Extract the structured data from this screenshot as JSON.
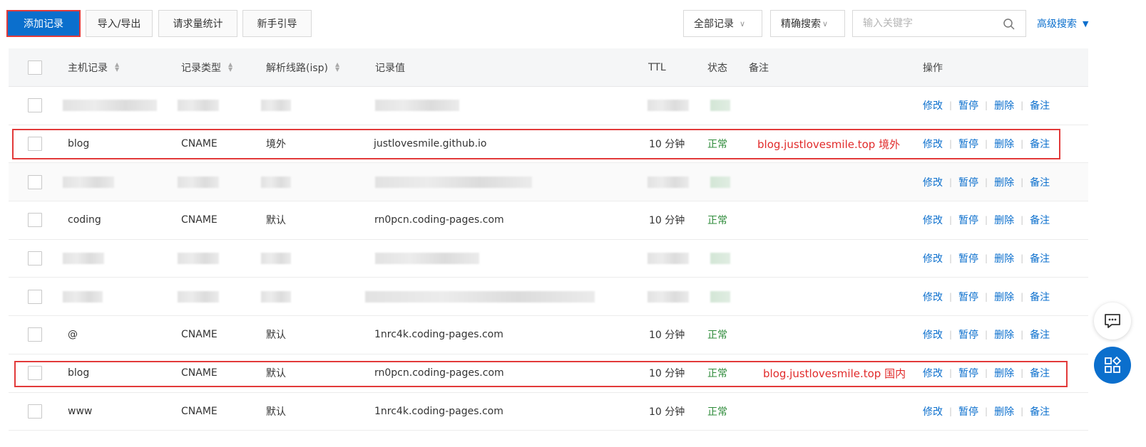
{
  "toolbar": {
    "add_record": "添加记录",
    "import_export": "导入/导出",
    "request_stats": "请求量统计",
    "newbie_guide": "新手引导",
    "all_records": "全部记录",
    "exact_search": "精确搜索",
    "search_placeholder": "输入关键字",
    "advanced_search": "高级搜索"
  },
  "table": {
    "headers": {
      "host": "主机记录",
      "type": "记录类型",
      "line": "解析线路(isp)",
      "value": "记录值",
      "ttl": "TTL",
      "status": "状态",
      "remark": "备注",
      "actions": "操作"
    },
    "actions": {
      "edit": "修改",
      "pause": "暂停",
      "delete": "删除",
      "remark": "备注"
    },
    "rows": [
      {
        "host": "",
        "type": "",
        "line": "",
        "value": "",
        "ttl": "",
        "status": "",
        "note": "",
        "blurred": true
      },
      {
        "host": "blog",
        "type": "CNAME",
        "line": "境外",
        "value": "justlovesmile.github.io",
        "ttl": "10 分钟",
        "status": "正常",
        "note": "blog.justlovesmile.top  境外"
      },
      {
        "host": "",
        "type": "",
        "line": "",
        "value": "",
        "ttl": "",
        "status": "",
        "note": "",
        "blurred": true
      },
      {
        "host": "coding",
        "type": "CNAME",
        "line": "默认",
        "value": "rn0pcn.coding-pages.com",
        "ttl": "10 分钟",
        "status": "正常",
        "note": ""
      },
      {
        "host": "",
        "type": "",
        "line": "",
        "value": "",
        "ttl": "",
        "status": "",
        "note": "",
        "blurred": true
      },
      {
        "host": "",
        "type": "",
        "line": "",
        "value": "",
        "ttl": "",
        "status": "",
        "note": "",
        "blurred": true
      },
      {
        "host": "@",
        "type": "CNAME",
        "line": "默认",
        "value": "1nrc4k.coding-pages.com",
        "ttl": "10 分钟",
        "status": "正常",
        "note": ""
      },
      {
        "host": "blog",
        "type": "CNAME",
        "line": "默认",
        "value": "rn0pcn.coding-pages.com",
        "ttl": "10 分钟",
        "status": "正常",
        "note": "blog.justlovesmile.top 国内"
      },
      {
        "host": "www",
        "type": "CNAME",
        "line": "默认",
        "value": "1nrc4k.coding-pages.com",
        "ttl": "10 分钟",
        "status": "正常",
        "note": ""
      }
    ]
  },
  "colors": {
    "primary": "#0b6fcd",
    "status_ok": "#2e8b3a",
    "highlight": "#e23a3a"
  },
  "icons": [
    "search-icon",
    "chevron-down-icon",
    "sort-icon",
    "chat-icon",
    "apps-icon"
  ]
}
